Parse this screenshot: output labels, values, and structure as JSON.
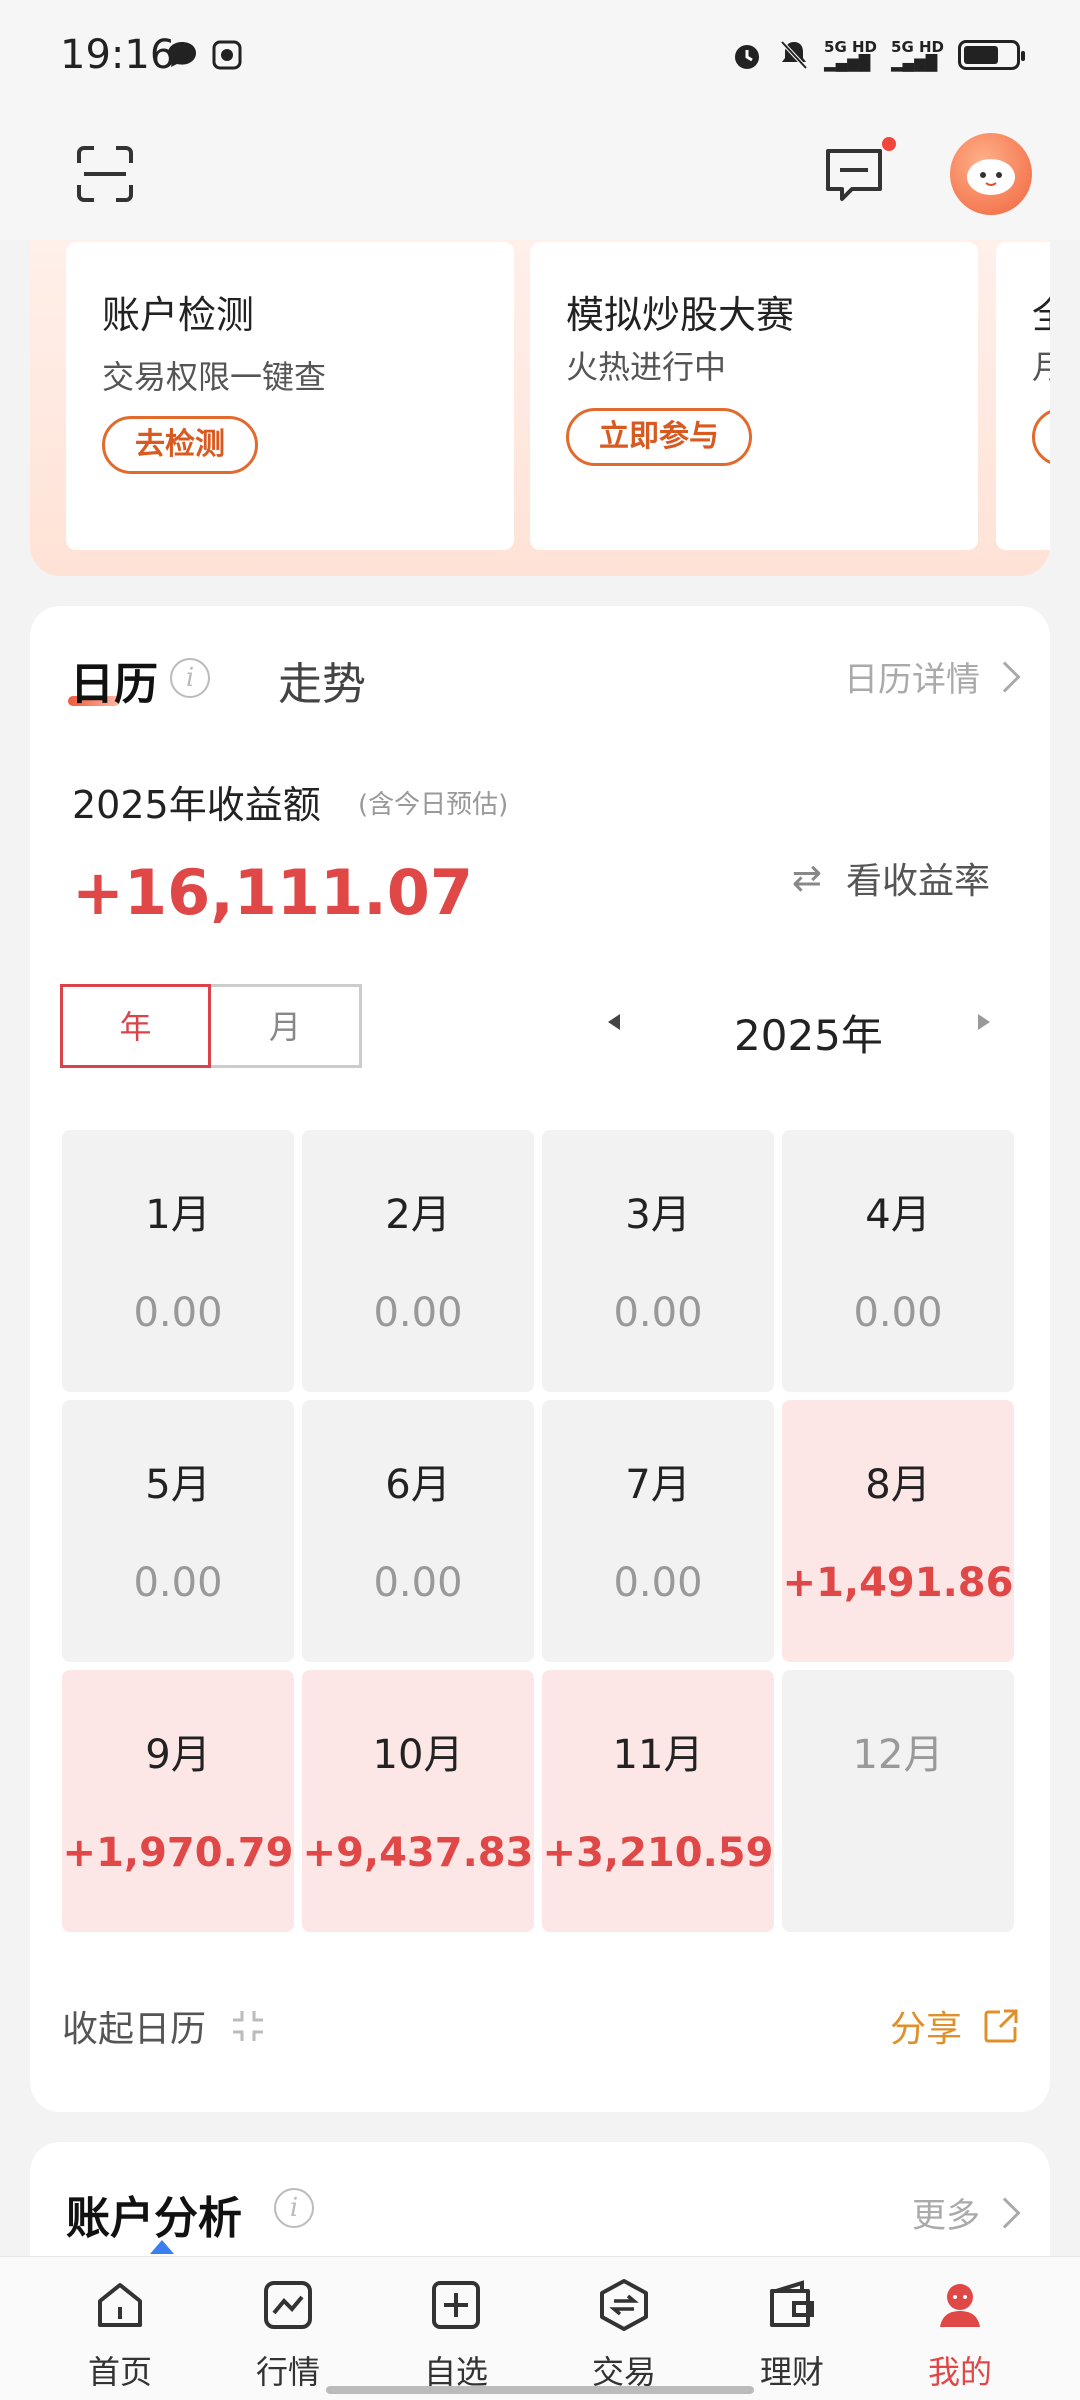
{
  "status": {
    "time": "19:16",
    "net1": "5G HD",
    "net2": "5G HD"
  },
  "topbar": {
    "scan_icon": "scan-icon",
    "message_icon": "message-icon",
    "avatar": "avatar"
  },
  "promos": [
    {
      "title": "账户检测",
      "subtitle": "交易权限一键查",
      "button": "去检测"
    },
    {
      "title": "模拟炒股大赛",
      "subtitle": "火热进行中",
      "button": "立即参与"
    },
    {
      "title": "全",
      "subtitle": "月",
      "button": ""
    }
  ],
  "calendar": {
    "tab_calendar": "日历",
    "tab_trend": "走势",
    "detail_link": "日历详情",
    "earn_label": "2025年收益额",
    "earn_note": "(含今日预估)",
    "earn_value": "+16,111.07",
    "rate_button": "看收益率",
    "seg_year": "年",
    "seg_month": "月",
    "year": "2025年",
    "months": [
      {
        "month": "1月",
        "value": "0.00",
        "state": "zero"
      },
      {
        "month": "2月",
        "value": "0.00",
        "state": "zero"
      },
      {
        "month": "3月",
        "value": "0.00",
        "state": "zero"
      },
      {
        "month": "4月",
        "value": "0.00",
        "state": "zero"
      },
      {
        "month": "5月",
        "value": "0.00",
        "state": "zero"
      },
      {
        "month": "6月",
        "value": "0.00",
        "state": "zero"
      },
      {
        "month": "7月",
        "value": "0.00",
        "state": "zero"
      },
      {
        "month": "8月",
        "value": "+1,491.86",
        "state": "pos"
      },
      {
        "month": "9月",
        "value": "+1,970.79",
        "state": "pos"
      },
      {
        "month": "10月",
        "value": "+9,437.83",
        "state": "pos"
      },
      {
        "month": "11月",
        "value": "+3,210.59",
        "state": "pos"
      },
      {
        "month": "12月",
        "value": "",
        "state": "future"
      }
    ],
    "collapse_label": "收起日历",
    "share_label": "分享"
  },
  "account": {
    "title": "账户分析",
    "more": "更多"
  },
  "nav": [
    {
      "label": "首页",
      "icon": "home-icon"
    },
    {
      "label": "行情",
      "icon": "chart-icon"
    },
    {
      "label": "自选",
      "icon": "plus-square-icon"
    },
    {
      "label": "交易",
      "icon": "exchange-icon"
    },
    {
      "label": "理财",
      "icon": "wallet-icon"
    },
    {
      "label": "我的",
      "icon": "profile-icon",
      "active": true
    }
  ],
  "colors": {
    "accent_red": "#e04848",
    "accent_orange": "#e0902a",
    "positive_bg": "#fde6e6"
  }
}
